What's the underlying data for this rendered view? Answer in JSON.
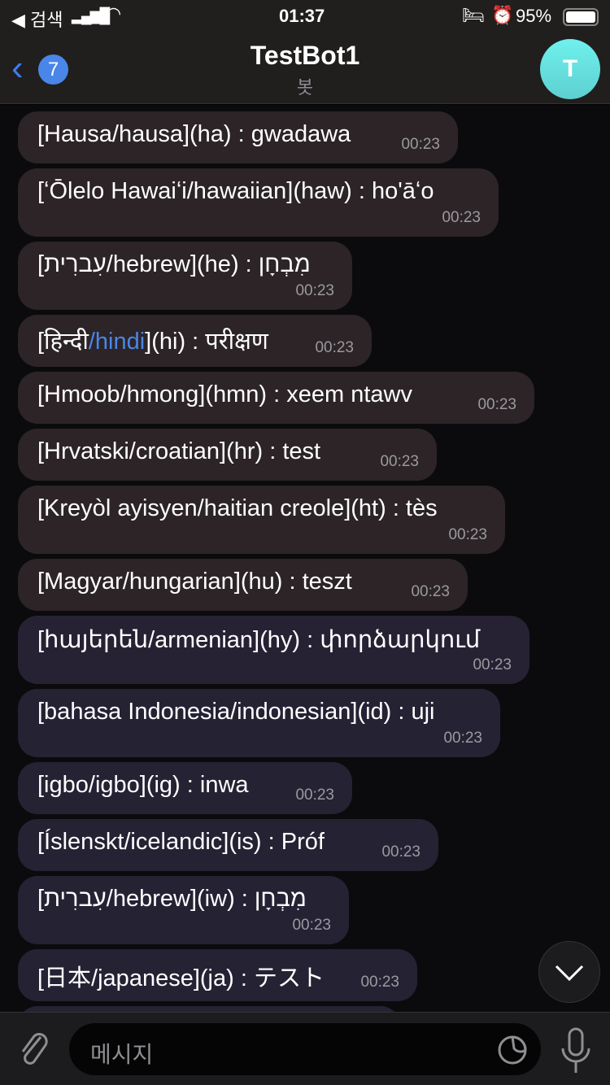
{
  "status": {
    "back_app": "◀ 검색",
    "time": "01:37",
    "battery": "95%"
  },
  "header": {
    "back_count": "7",
    "title": "TestBot1",
    "subtitle": "봇",
    "avatar_letter": "T"
  },
  "messages": [
    {
      "text": "[Hausa/hausa](ha) : gwadawa",
      "time": "00:23"
    },
    {
      "text": "[ʻŌlelo Hawaiʻi/hawaiian](haw) : ho'āʻo",
      "time": "00:23"
    },
    {
      "text": "מִבְחָן : (he)[hebrew/עִברִית]",
      "time": "00:23"
    },
    {
      "pre": "[हिन्दी",
      "link": "/hindi",
      "post": "](hi) : परीक्षण",
      "time": "00:23"
    },
    {
      "text": "[Hmoob/hmong](hmn) : xeem ntawv",
      "time": "00:23"
    },
    {
      "text": "[Hrvatski/croatian](hr) : test",
      "time": "00:23"
    },
    {
      "text": "[Kreyòl ayisyen/haitian creole](ht) : tès",
      "time": "00:23"
    },
    {
      "text": "[Magyar/hungarian](hu) : teszt",
      "time": "00:23"
    },
    {
      "text": "[հայերեն/armenian](hy) : փորձարկում",
      "time": "00:23"
    },
    {
      "text": "[bahasa Indonesia/indonesian](id) : uji",
      "time": "00:23"
    },
    {
      "text": "[igbo/igbo](ig) : inwa",
      "time": "00:23"
    },
    {
      "text": "[Íslenskt/icelandic](is) : Próf",
      "time": "00:23"
    },
    {
      "text": "מִבְחָן : (iw)[hebrew/עִברִית]",
      "time": "00:23"
    },
    {
      "text": "[日本/japanese](ja) : テスト",
      "time": "00:23"
    }
  ],
  "input": {
    "placeholder": "메시지"
  }
}
